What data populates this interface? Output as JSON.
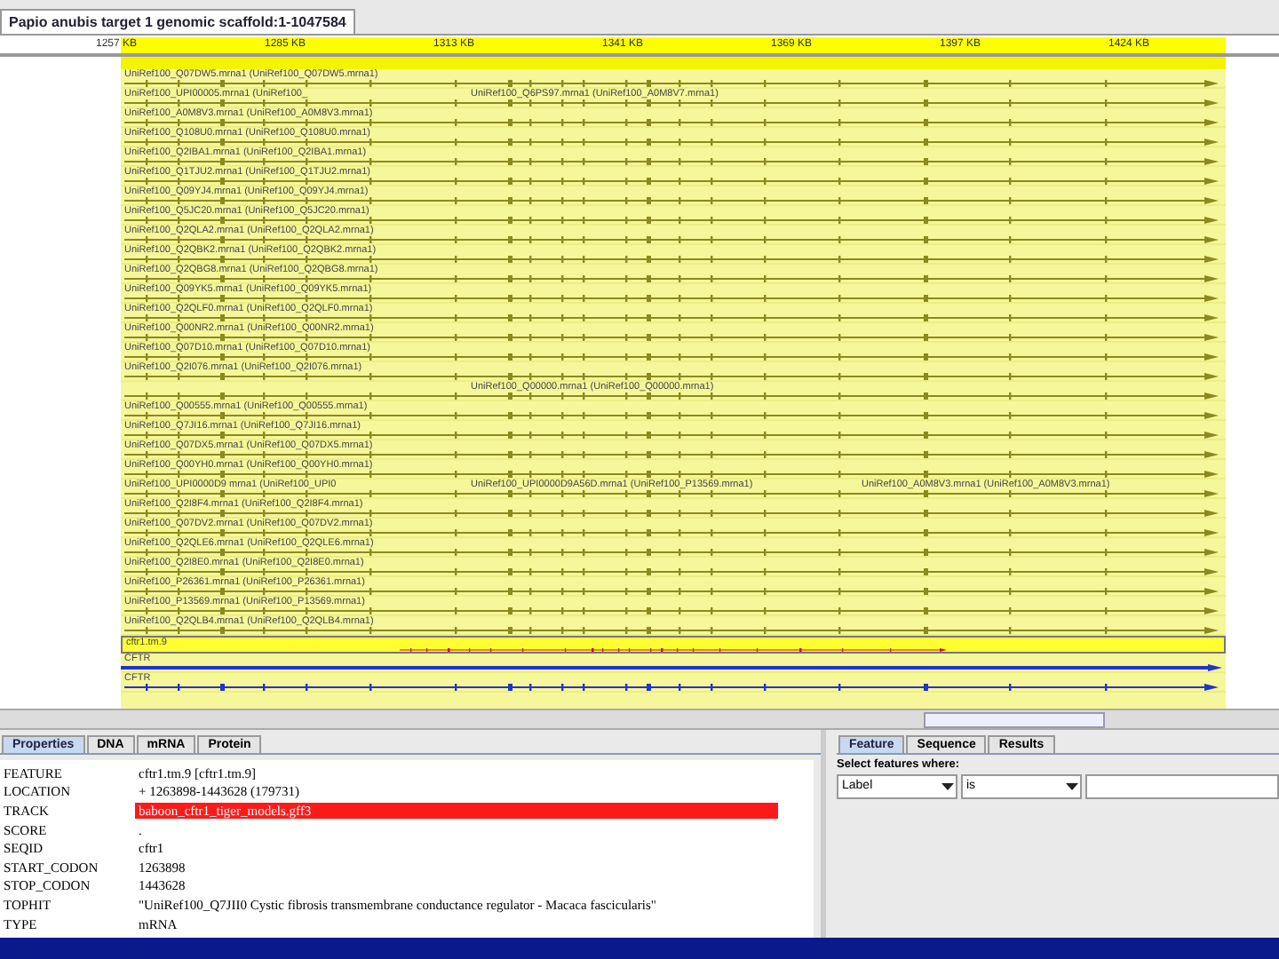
{
  "window": {
    "title": "Papio anubis target 1 genomic scaffold:1-1047584"
  },
  "ruler": {
    "labels": [
      "1257 KB",
      "1285 KB",
      "1313 KB",
      "1341 KB",
      "1369 KB",
      "1397 KB",
      "1424 KB"
    ]
  },
  "tracks": [
    {
      "kind": "hit",
      "selected": false,
      "labels": [
        "UniRef100_Q07DW5.mrna1 (UniRef100_Q07DW5.mrna1)"
      ]
    },
    {
      "kind": "hit",
      "selected": false,
      "labels": [
        "UniRef100_UPI00005.mrna1 (UniRef100_",
        "UniRef100_Q6PS97.mrna1 (UniRef100_A0M8V7.mrna1)"
      ]
    },
    {
      "kind": "hit",
      "selected": false,
      "labels": [
        "UniRef100_A0M8V3.mrna1 (UniRef100_A0M8V3.mrna1)"
      ]
    },
    {
      "kind": "hit",
      "selected": false,
      "labels": [
        "UniRef100_Q108U0.mrna1 (UniRef100_Q108U0.mrna1)"
      ]
    },
    {
      "kind": "hit",
      "selected": false,
      "labels": [
        "UniRef100_Q2IBA1.mrna1 (UniRef100_Q2IBA1.mrna1)"
      ]
    },
    {
      "kind": "hit",
      "selected": false,
      "labels": [
        "UniRef100_Q1TJU2.mrna1 (UniRef100_Q1TJU2.mrna1)"
      ]
    },
    {
      "kind": "hit",
      "selected": false,
      "labels": [
        "UniRef100_Q09YJ4.mrna1 (UniRef100_Q09YJ4.mrna1)"
      ]
    },
    {
      "kind": "hit",
      "selected": false,
      "labels": [
        "UniRef100_Q5JC20.mrna1 (UniRef100_Q5JC20.mrna1)"
      ]
    },
    {
      "kind": "hit",
      "selected": false,
      "labels": [
        "UniRef100_Q2QLA2.mrna1 (UniRef100_Q2QLA2.mrna1)"
      ]
    },
    {
      "kind": "hit",
      "selected": false,
      "labels": [
        "UniRef100_Q2QBK2.mrna1 (UniRef100_Q2QBK2.mrna1)"
      ]
    },
    {
      "kind": "hit",
      "selected": false,
      "labels": [
        "UniRef100_Q2QBG8.mrna1 (UniRef100_Q2QBG8.mrna1)"
      ]
    },
    {
      "kind": "hit",
      "selected": false,
      "labels": [
        "UniRef100_Q09YK5.mrna1 (UniRef100_Q09YK5.mrna1)"
      ]
    },
    {
      "kind": "hit",
      "selected": false,
      "labels": [
        "UniRef100_Q2QLF0.mrna1 (UniRef100_Q2QLF0.mrna1)"
      ]
    },
    {
      "kind": "hit",
      "selected": false,
      "labels": [
        "UniRef100_Q00NR2.mrna1 (UniRef100_Q00NR2.mrna1)"
      ]
    },
    {
      "kind": "hit",
      "selected": false,
      "labels": [
        "UniRef100_Q07D10.mrna1 (UniRef100_Q07D10.mrna1)"
      ]
    },
    {
      "kind": "hit",
      "selected": false,
      "labels": [
        "UniRef100_Q2I076.mrna1 (UniRef100_Q2I076.mrna1)"
      ]
    },
    {
      "kind": "offset-hit",
      "selected": false,
      "labels": [
        "UniRef100_Q00000.mrna1 (UniRef100_Q00000.mrna1)"
      ]
    },
    {
      "kind": "hit",
      "selected": false,
      "labels": [
        "UniRef100_Q00555.mrna1 (UniRef100_Q00555.mrna1)"
      ]
    },
    {
      "kind": "hit",
      "selected": false,
      "labels": [
        "UniRef100_Q7JI16.mrna1 (UniRef100_Q7JI16.mrna1)"
      ]
    },
    {
      "kind": "hit",
      "selected": false,
      "labels": [
        "UniRef100_Q07DX5.mrna1 (UniRef100_Q07DX5.mrna1)"
      ]
    },
    {
      "kind": "hit",
      "selected": false,
      "labels": [
        "UniRef100_Q00YH0.mrna1 (UniRef100_Q00YH0.mrna1)"
      ]
    },
    {
      "kind": "hit",
      "selected": false,
      "labels": [
        "UniRef100_UPI0000D9 mrna1 (UniRef100_UPI0",
        "UniRef100_UPI0000D9A56D.mrna1 (UniRef100_P13569.mrna1)",
        "UniRef100_A0M8V3.mrna1 (UniRef100_A0M8V3.mrna1)"
      ]
    },
    {
      "kind": "hit",
      "selected": false,
      "labels": [
        "UniRef100_Q2I8F4.mrna1 (UniRef100_Q2I8F4.mrna1)"
      ]
    },
    {
      "kind": "hit",
      "selected": false,
      "labels": [
        "UniRef100_Q07DV2.mrna1 (UniRef100_Q07DV2.mrna1)"
      ]
    },
    {
      "kind": "hit",
      "selected": false,
      "labels": [
        "UniRef100_Q2QLE6.mrna1 (UniRef100_Q2QLE6.mrna1)"
      ]
    },
    {
      "kind": "hit",
      "selected": false,
      "labels": [
        "UniRef100_Q2I8E0.mrna1 (UniRef100_Q2I8E0.mrna1)"
      ]
    },
    {
      "kind": "hit",
      "selected": false,
      "labels": [
        "UniRef100_P26361.mrna1 (UniRef100_P26361.mrna1)"
      ]
    },
    {
      "kind": "hit",
      "selected": false,
      "labels": [
        "UniRef100_P13569.mrna1 (UniRef100_P13569.mrna1)"
      ]
    },
    {
      "kind": "hit",
      "selected": false,
      "labels": [
        "UniRef100_Q2QLB4.mrna1 (UniRef100_Q2QLB4.mrna1)"
      ]
    },
    {
      "kind": "model",
      "selected": true,
      "labels": [
        "cftr1.tm.9"
      ]
    },
    {
      "kind": "arrow",
      "selected": false,
      "labels": [
        "CFTR"
      ]
    },
    {
      "kind": "ticks",
      "selected": false,
      "labels": [
        "CFTR"
      ]
    }
  ],
  "properties_panel": {
    "tabs": [
      {
        "label": "Properties",
        "selected": true
      },
      {
        "label": "DNA",
        "selected": false
      },
      {
        "label": "mRNA",
        "selected": false
      },
      {
        "label": "Protein",
        "selected": false
      }
    ],
    "rows": [
      {
        "key": "FEATURE",
        "value": "cftr1.tm.9 [cftr1.tm.9]",
        "selected": false
      },
      {
        "key": "LOCATION",
        "value": "+ 1263898-1443628 (179731)",
        "selected": false
      },
      {
        "key": "TRACK",
        "value": "baboon_cftr1_tiger_models.gff3",
        "selected": true
      },
      {
        "key": "SCORE",
        "value": ".",
        "selected": false
      },
      {
        "key": "SEQID",
        "value": "cftr1",
        "selected": false
      },
      {
        "key": "START_CODON",
        "value": "1263898",
        "selected": false
      },
      {
        "key": "STOP_CODON",
        "value": "1443628",
        "selected": false
      },
      {
        "key": "TOPHIT",
        "value": "\"UniRef100_Q7JII0 Cystic fibrosis transmembrane conductance regulator - Macaca fascicularis\"",
        "selected": false
      },
      {
        "key": "TYPE",
        "value": "mRNA",
        "selected": false
      }
    ]
  },
  "filter_panel": {
    "tabs": [
      {
        "label": "Feature",
        "selected": true
      },
      {
        "label": "Sequence",
        "selected": false
      },
      {
        "label": "Results",
        "selected": false
      }
    ],
    "heading": "Select features where:",
    "field": "Label",
    "operator": "is"
  }
}
